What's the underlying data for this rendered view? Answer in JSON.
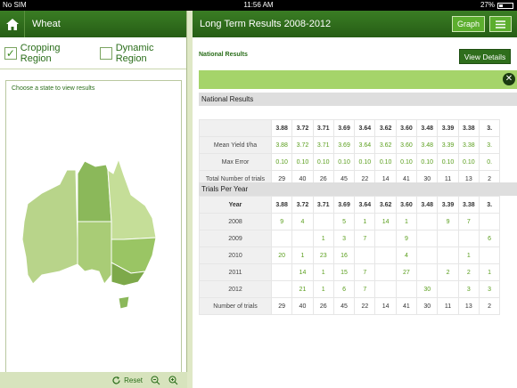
{
  "status_bar": {
    "carrier": "No SIM",
    "time": "11:56 AM",
    "battery": "27%"
  },
  "left_panel": {
    "title": "Wheat",
    "regions": [
      {
        "label": "Cropping Region",
        "checked": true
      },
      {
        "label": "Dynamic Region",
        "checked": false
      }
    ],
    "checkmark": "✓",
    "prompt": "Choose a state to view results",
    "reset_label": "Reset"
  },
  "right_panel": {
    "title": "Long Term Results 2008-2012",
    "graph_label": "Graph",
    "national_heading": "National Results",
    "view_details_label": "View Details",
    "close_glyph": "✕",
    "national_section": "National Results",
    "national_header": [
      "3.88",
      "3.72",
      "3.71",
      "3.69",
      "3.64",
      "3.62",
      "3.60",
      "3.48",
      "3.39",
      "3.38",
      "3."
    ],
    "national_rows": [
      {
        "label": "Mean Yield t/ha",
        "values": [
          "3.88",
          "3.72",
          "3.71",
          "3.69",
          "3.64",
          "3.62",
          "3.60",
          "3.48",
          "3.39",
          "3.38",
          "3."
        ]
      },
      {
        "label": "Max Error",
        "values": [
          "0.10",
          "0.10",
          "0.10",
          "0.10",
          "0.10",
          "0.10",
          "0.10",
          "0.10",
          "0.10",
          "0.10",
          "0."
        ]
      },
      {
        "label": "Total Number of trials",
        "values": [
          "29",
          "40",
          "26",
          "45",
          "22",
          "14",
          "41",
          "30",
          "11",
          "13",
          "2"
        ]
      }
    ],
    "trials_section": "Trials Per Year",
    "trials_header": {
      "label": "Year",
      "values": [
        "3.88",
        "3.72",
        "3.71",
        "3.69",
        "3.64",
        "3.62",
        "3.60",
        "3.48",
        "3.39",
        "3.38",
        "3."
      ]
    },
    "trials_rows": [
      {
        "label": "2008",
        "values": [
          "9",
          "4",
          "",
          "5",
          "1",
          "14",
          "1",
          "",
          "9",
          "7",
          ""
        ]
      },
      {
        "label": "2009",
        "values": [
          "",
          "",
          "1",
          "3",
          "7",
          "",
          "9",
          "",
          "",
          "",
          "6"
        ]
      },
      {
        "label": "2010",
        "values": [
          "20",
          "1",
          "23",
          "16",
          "",
          "",
          "4",
          "",
          "",
          "1",
          ""
        ]
      },
      {
        "label": "2011",
        "values": [
          "",
          "14",
          "1",
          "15",
          "7",
          "",
          "27",
          "",
          "2",
          "2",
          "1"
        ]
      },
      {
        "label": "2012",
        "values": [
          "",
          "21",
          "1",
          "6",
          "7",
          "",
          "",
          "30",
          "",
          "3",
          "3"
        ]
      },
      {
        "label": "Number of trials",
        "values": [
          "29",
          "40",
          "26",
          "45",
          "22",
          "14",
          "41",
          "30",
          "11",
          "13",
          "2"
        ]
      }
    ]
  },
  "colors": {
    "header": "#2f6e1c",
    "accent": "#5cae2e",
    "bar": "#a5d46a",
    "value_green": "#5a9e1c"
  }
}
